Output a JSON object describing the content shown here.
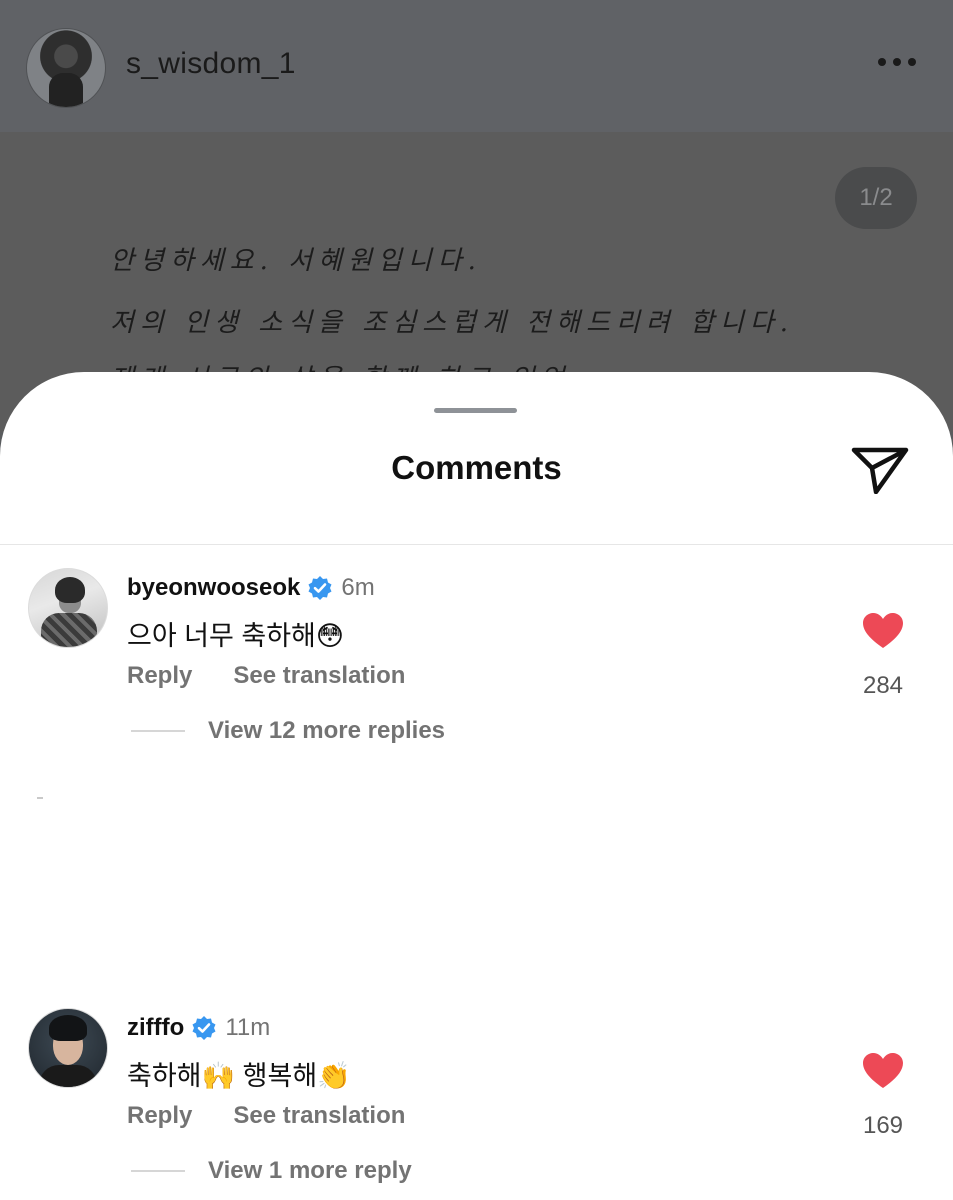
{
  "post": {
    "username": "s_wisdom_1",
    "page_indicator": "1/2",
    "image_text_lines": [
      "안녕하세요. 서혜원입니다.",
      "저의 인생 소식을 조심스럽게 전해드리려 합니다.",
      "제게 서로의 삶을 함께 하고 있었"
    ]
  },
  "sheet": {
    "title": "Comments"
  },
  "comments": [
    {
      "username": "byeonwooseok",
      "verified": true,
      "time": "6m",
      "text": "으아 너무 축하해😳",
      "reply_label": "Reply",
      "translate_label": "See translation",
      "likes": "284",
      "view_replies": "View 12 more replies"
    },
    {
      "username": "zifffo",
      "verified": true,
      "time": "11m",
      "text": "축하해🙌 행복해👏",
      "reply_label": "Reply",
      "translate_label": "See translation",
      "likes": "169",
      "view_replies": "View 1 more reply"
    }
  ],
  "colors": {
    "heart": "#ed4956",
    "verified": "#3897f0",
    "secondary_text": "#737373"
  },
  "icons": [
    "more-options-icon",
    "share-icon",
    "verified-badge-icon",
    "heart-icon"
  ]
}
